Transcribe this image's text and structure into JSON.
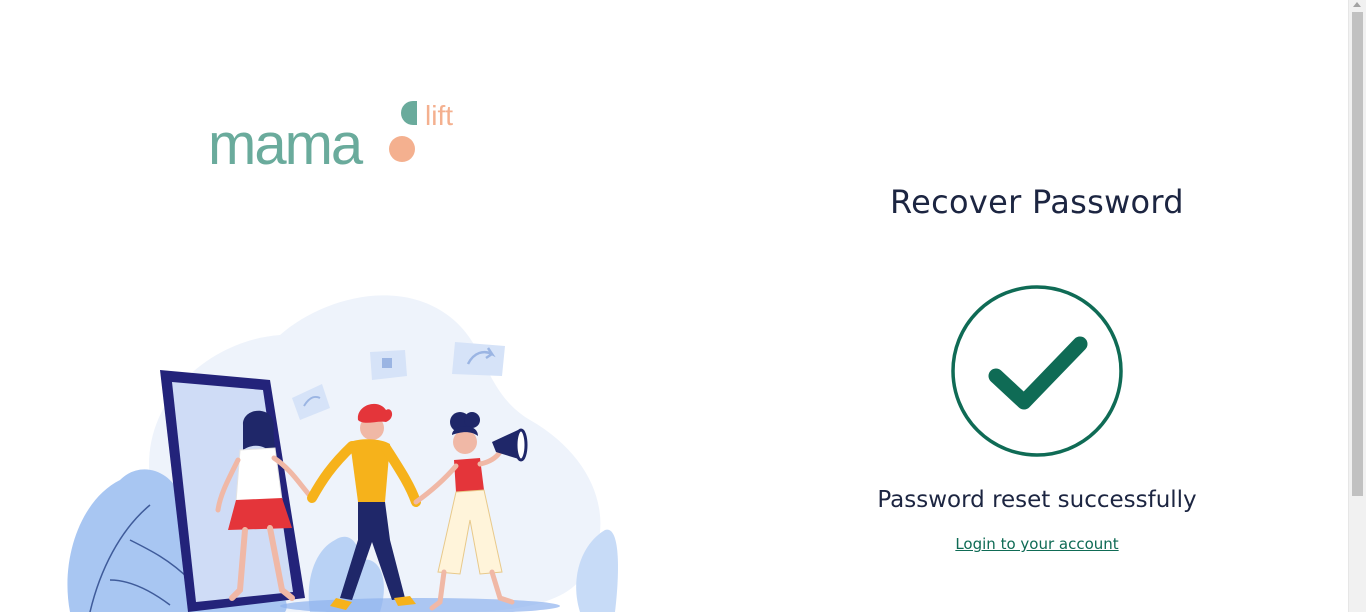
{
  "brand": {
    "logo_main": "mama",
    "logo_sub": "lift",
    "primary_color": "#6aab9c",
    "accent_color": "#f4b08f"
  },
  "recover": {
    "title": "Recover Password",
    "status_icon": "check-circle-icon",
    "message": "Password reset successfully",
    "login_link": "Login to your account",
    "accent_color": "#0f6b55"
  },
  "illustration": {
    "icon": "people-walking-phone-illustration"
  }
}
